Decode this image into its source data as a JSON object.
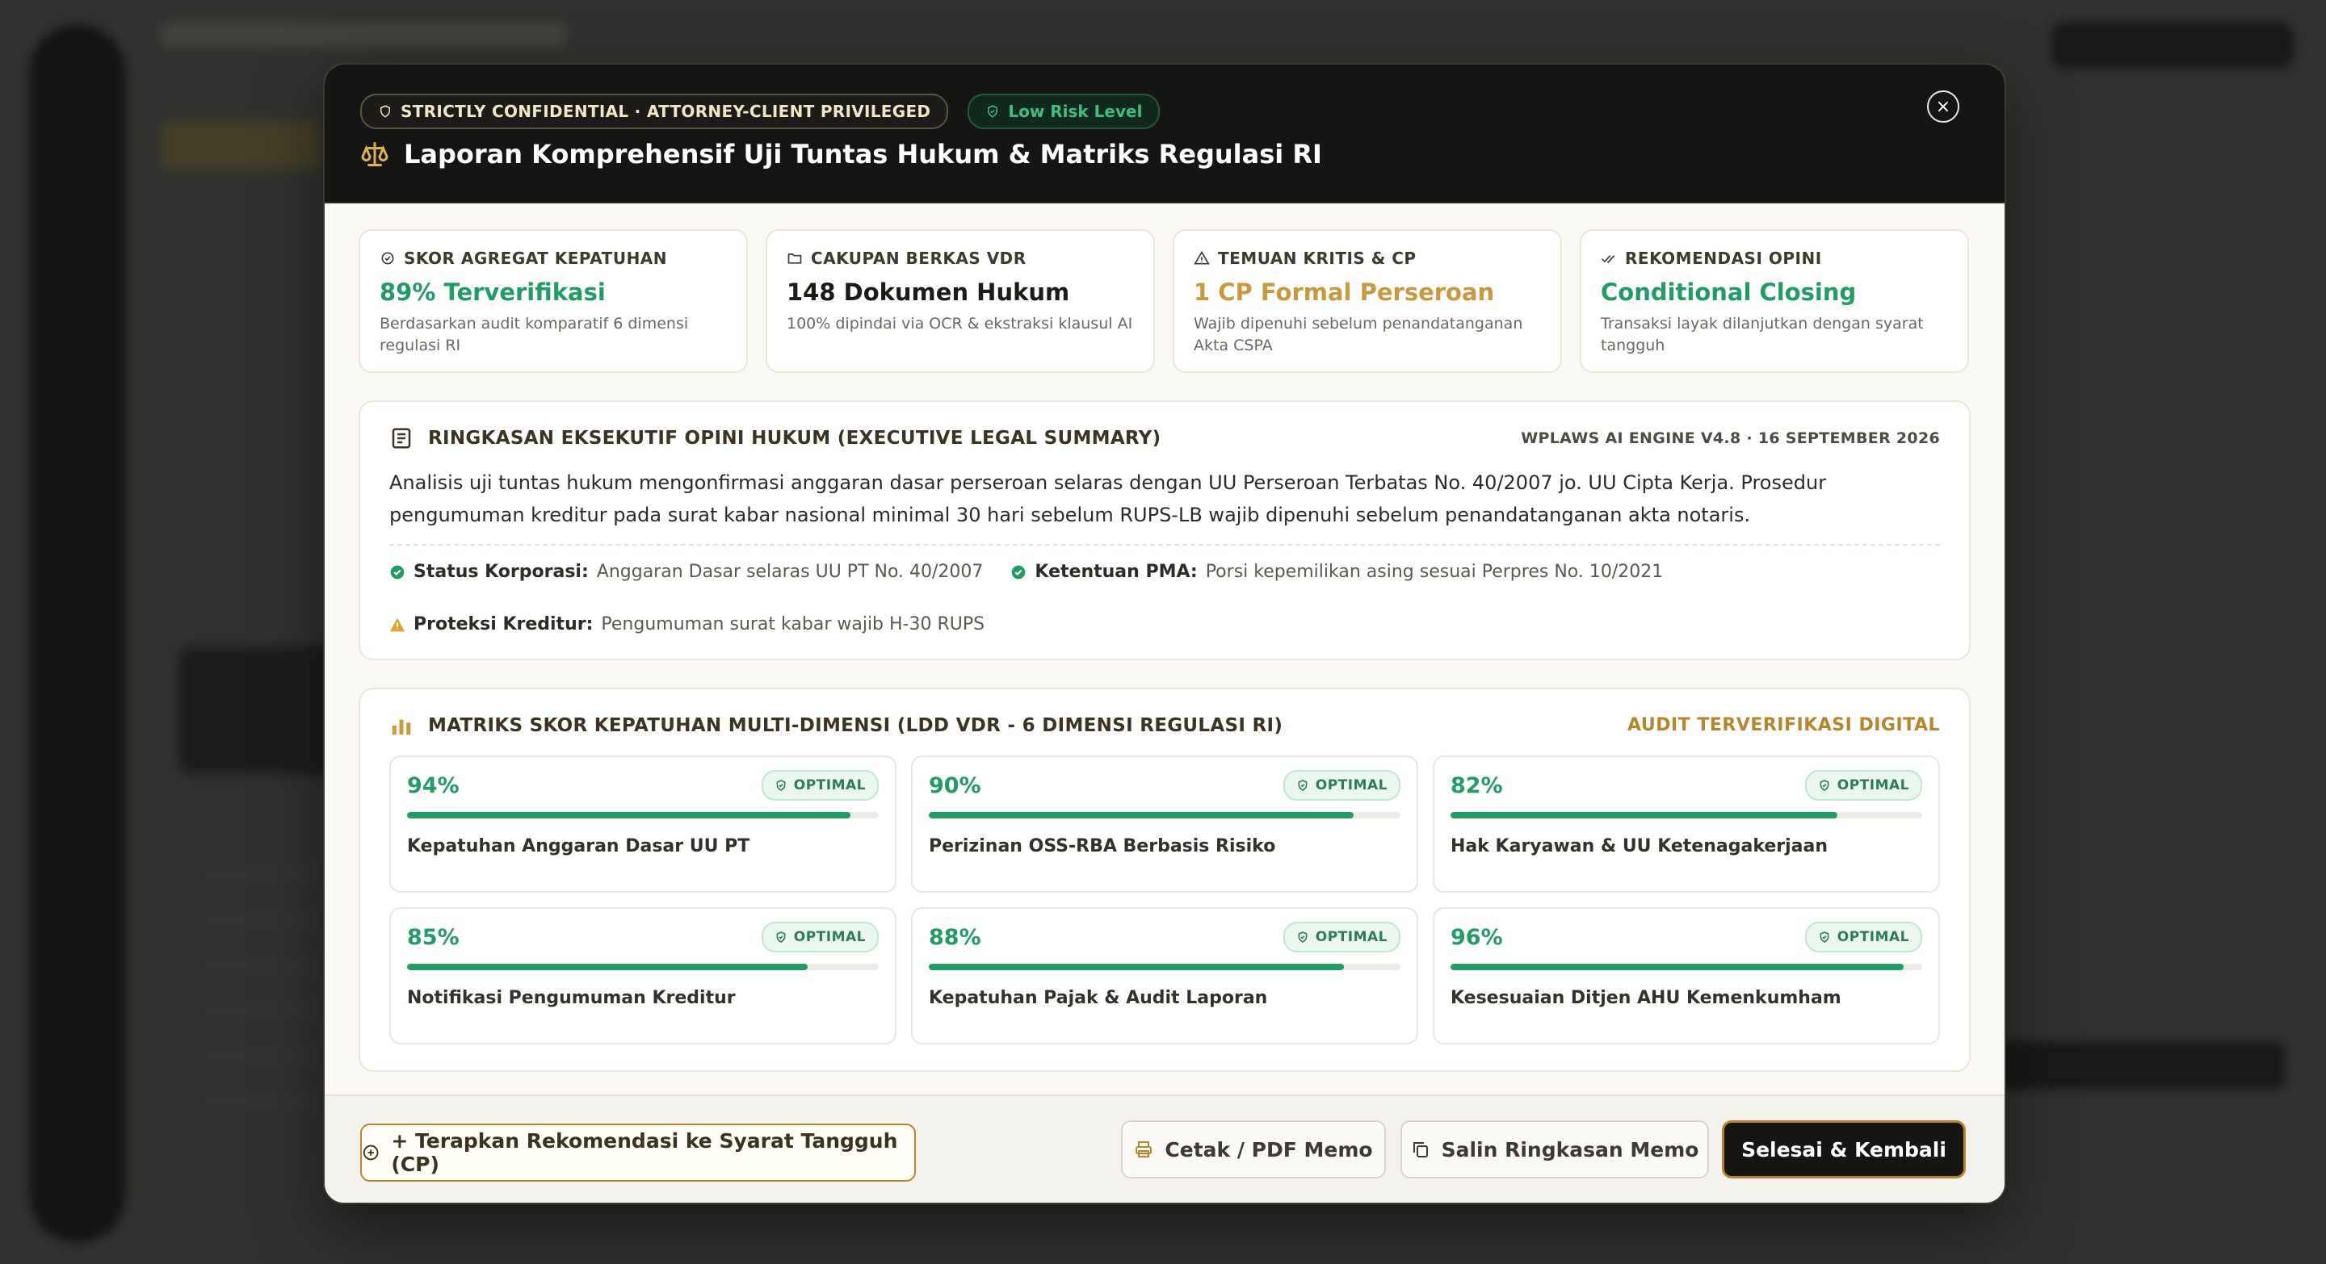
{
  "header": {
    "confidential_chip": "STRICTLY CONFIDENTIAL · ATTORNEY-CLIENT PRIVILEGED",
    "risk_chip": "Low Risk Level",
    "title": "Laporan Komprehensif Uji Tuntas Hukum & Matriks Regulasi RI",
    "close_label": "×"
  },
  "kpis": [
    {
      "label": "SKOR AGREGAT KEPATUHAN",
      "value": "89% Terverifikasi",
      "desc": "Berdasarkan audit komparatif 6 dimensi regulasi RI",
      "color": "#1f9d63",
      "icon": "badge-check-icon"
    },
    {
      "label": "CAKUPAN BERKAS VDR",
      "value": "148 Dokumen Hukum",
      "desc": "100% dipindai via OCR & ekstraksi klausul AI",
      "color": "#1c1b17",
      "icon": "folder-icon"
    },
    {
      "label": "TEMUAN KRITIS & CP",
      "value": "1 CP Formal Perseroan",
      "desc": "Wajib dipenuhi sebelum penandatanganan Akta CSPA",
      "color": "#c99a3c",
      "icon": "warning-icon"
    },
    {
      "label": "REKOMENDASI OPINI",
      "value": "Conditional Closing",
      "desc": "Transaksi layak dilanjutkan dengan syarat tangguh",
      "color": "#1f9d63",
      "icon": "double-check-icon"
    }
  ],
  "summary": {
    "heading": "RINGKASAN EKSEKUTIF OPINI HUKUM (EXECUTIVE LEGAL SUMMARY)",
    "meta": "WPLAWS AI ENGINE V4.8 · 16 SEPTEMBER 2026",
    "text": "Analisis uji tuntas hukum mengonfirmasi anggaran dasar perseroan selaras dengan UU Perseroan Terbatas No. 40/2007 jo. UU Cipta Kerja. Prosedur pengumuman kreditur pada surat kabar nasional minimal 30 hari sebelum RUPS-LB wajib dipenuhi sebelum penandatanganan akta notaris.",
    "facts": [
      {
        "label": "Status Korporasi:",
        "value": "Anggaran Dasar selaras UU PT No. 40/2007",
        "status": "ok"
      },
      {
        "label": "Ketentuan PMA:",
        "value": "Porsi kepemilikan asing sesuai Perpres No. 10/2021",
        "status": "ok"
      },
      {
        "label": "Proteksi Kreditur:",
        "value": "Pengumuman surat kabar wajib H-30 RUPS",
        "status": "warn"
      }
    ]
  },
  "matrix": {
    "heading": "MATRIKS SKOR KEPATUHAN MULTI-DIMENSI (LDD VDR - 6 DIMENSI REGULASI RI)",
    "meta": "AUDIT TERVERIFIKASI DIGITAL",
    "badge_label": "OPTIMAL",
    "items": [
      {
        "percent": "94%",
        "value": 94,
        "name": "Kepatuhan Anggaran Dasar UU PT"
      },
      {
        "percent": "90%",
        "value": 90,
        "name": "Perizinan OSS-RBA Berbasis Risiko"
      },
      {
        "percent": "82%",
        "value": 82,
        "name": "Hak Karyawan & UU Ketenagakerjaan"
      },
      {
        "percent": "85%",
        "value": 85,
        "name": "Notifikasi Pengumuman Kreditur"
      },
      {
        "percent": "88%",
        "value": 88,
        "name": "Kepatuhan Pajak & Audit Laporan"
      },
      {
        "percent": "96%",
        "value": 96,
        "name": "Kesesuaian Ditjen AHU Kemenkumham"
      }
    ]
  },
  "footer": {
    "apply_label": "+ Terapkan Rekomendasi ke Syarat Tangguh (CP)",
    "print_label": "Cetak / PDF Memo",
    "copy_label": "Salin Ringkasan Memo",
    "done_label": "Selesai & Kembali"
  },
  "colors": {
    "accent_gold": "#b5862a",
    "success_green": "#1f9d63",
    "warning_amber": "#e0a526",
    "header_dark": "#151513"
  }
}
